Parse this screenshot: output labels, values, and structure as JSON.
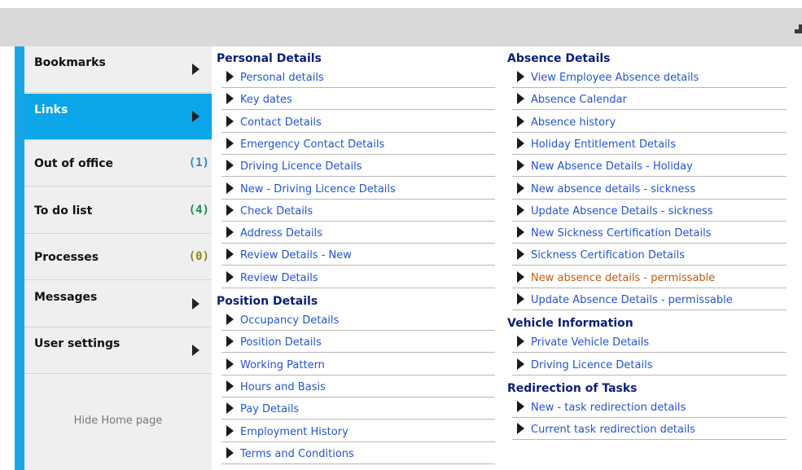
{
  "sidebar": {
    "items": [
      {
        "label": "Bookmarks",
        "count": "",
        "count_color": "",
        "arrow": true,
        "active": false
      },
      {
        "label": "Links",
        "count": "",
        "count_color": "",
        "arrow": true,
        "active": true
      },
      {
        "label": "Out of office",
        "count": "(1)",
        "count_color": "#2a86c8",
        "arrow": false,
        "active": false
      },
      {
        "label": "To do list",
        "count": "(4)",
        "count_color": "#1d8a4c",
        "arrow": false,
        "active": false
      },
      {
        "label": "Processes",
        "count": "(0)",
        "count_color": "#8a8a12",
        "arrow": false,
        "active": false
      },
      {
        "label": "Messages",
        "count": "",
        "count_color": "",
        "arrow": true,
        "active": false
      },
      {
        "label": "User settings",
        "count": "",
        "count_color": "",
        "arrow": true,
        "active": false
      }
    ],
    "hide_home": "Hide Home page"
  },
  "columns": [
    {
      "sections": [
        {
          "title": "Personal Details",
          "links": [
            "Personal details",
            "Key dates",
            "Contact Details",
            "Emergency Contact Details",
            "Driving Licence Details",
            "New - Driving Licence Details",
            "Check Details",
            "Address Details",
            "Review Details - New",
            "Review Details"
          ]
        },
        {
          "title": "Position Details",
          "links": [
            "Occupancy Details",
            "Position Details",
            "Working Pattern",
            "Hours and Basis",
            "Pay Details",
            "Employment History",
            "Terms and Conditions"
          ]
        }
      ]
    },
    {
      "sections": [
        {
          "title": "Absence Details",
          "links": [
            "View Employee Absence details",
            "Absence Calendar",
            "Absence history",
            "Holiday Entitlement Details",
            "New Absence Details - Holiday",
            "New absence details - sickness",
            "Update Absence Details - sickness",
            "New Sickness Certification Details",
            "Sickness Certification Details",
            "New absence details - permissable",
            "Update Absence Details - permissable"
          ]
        },
        {
          "title": "Vehicle Information",
          "links": [
            "Private Vehicle Details",
            "Driving Licence Details"
          ]
        },
        {
          "title": "Redirection of Tasks",
          "links": [
            "New - task redirection details",
            "Current task redirection details"
          ]
        }
      ]
    }
  ],
  "highlighted_link": "New absence details - permissable",
  "colors": {
    "accent": "#0aa6e8",
    "link": "#2454d2",
    "section_title": "#0a1e7a",
    "highlight": "#c85a12"
  }
}
